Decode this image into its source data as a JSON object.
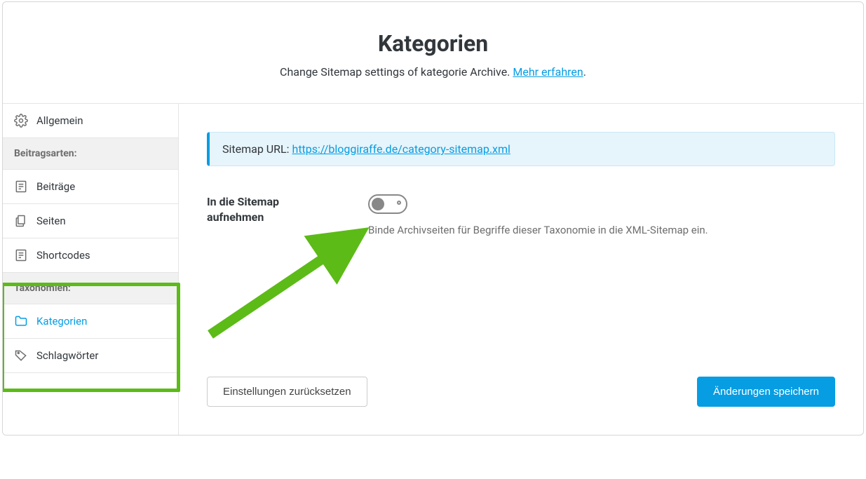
{
  "header": {
    "title": "Kategorien",
    "subtitle_prefix": "Change Sitemap settings of kategorie Archive. ",
    "subtitle_link": "Mehr erfahren",
    "subtitle_suffix": "."
  },
  "sidebar": {
    "general": "Allgemein",
    "heading_posttypes": "Beitragsarten:",
    "items_posttypes": [
      "Beiträge",
      "Seiten",
      "Shortcodes"
    ],
    "heading_taxonomies": "Taxonomien:",
    "items_taxonomies": [
      "Kategorien",
      "Schlagwörter"
    ]
  },
  "notice": {
    "prefix": "Sitemap URL: ",
    "url": "https://bloggiraffe.de/category-sitemap.xml"
  },
  "field": {
    "label": "In die Sitemap aufnehmen",
    "help": "Binde Archivseiten für Begriffe dieser Taxonomie in die XML-Sitemap ein.",
    "toggle_state": "off"
  },
  "footer": {
    "reset": "Einstellungen zurücksetzen",
    "save": "Änderungen speichern"
  }
}
